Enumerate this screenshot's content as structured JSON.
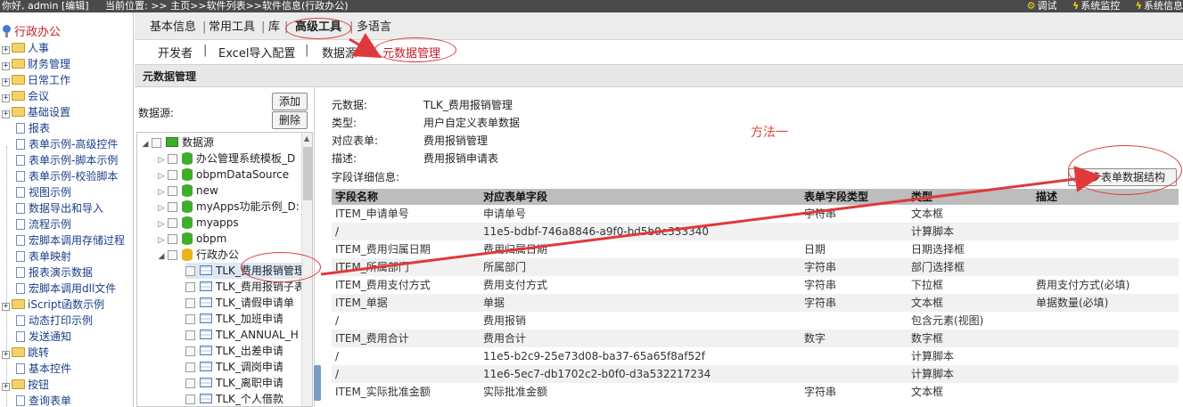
{
  "topbar": {
    "greeting": "你好, admin [编辑]",
    "location": "当前位置: >> 主页>>软件列表>>软件信息(行政办公)",
    "links": [
      "调试",
      "系统监控",
      "系统信息"
    ]
  },
  "left_tree": {
    "root": "行政办公",
    "folders": [
      "人事",
      "财务管理",
      "日常工作",
      "会议",
      "基础设置"
    ],
    "items": [
      "报表",
      "表单示例-高级控件",
      "表单示例-脚本示例",
      "表单示例-校验脚本",
      "视图示例",
      "数据导出和导入",
      "流程示例",
      "宏脚本调用存储过程",
      "表单映射",
      "报表演示数据",
      "宏脚本调用dll文件"
    ],
    "folders2": [
      "iScript函数示例"
    ],
    "items2": [
      "动态打印示例",
      "发送通知"
    ],
    "folders3": [
      "跳转"
    ],
    "items3": [
      "基本控件"
    ],
    "folders4": [
      "按钮"
    ],
    "items4": [
      "查询表单"
    ]
  },
  "tabs": [
    "基本信息",
    "常用工具",
    "库",
    "高级工具",
    "多语言"
  ],
  "subtabs": [
    "开发者",
    "Excel导入配置",
    "数据源",
    "元数据管理"
  ],
  "panel_title": "元数据管理",
  "datasource": {
    "label": "数据源:",
    "add_btn": "添加",
    "del_btn": "删除",
    "root": "数据源",
    "sources": [
      "办公管理系统模板_D",
      "obpmDataSource",
      "new",
      "myApps功能示例_D:",
      "myapps",
      "obpm"
    ],
    "app": "行政办公",
    "tables": [
      "TLK_费用报销管理",
      "TLK_费用报销子表",
      "TLK_请假申请单",
      "TLK_加班申请",
      "TLK_ANNUAL_H",
      "TLK_出差申请",
      "TLK_调岗申请",
      "TLK_离职申请",
      "TLK_个人借款"
    ]
  },
  "meta": {
    "fields": [
      {
        "k": "元数据:",
        "v": "TLK_费用报销管理"
      },
      {
        "k": "类型:",
        "v": "用户自定义表单数据"
      },
      {
        "k": "对应表单:",
        "v": "费用报销管理"
      },
      {
        "k": "描述:",
        "v": "费用报销申请表"
      },
      {
        "k": "字段详细信息:",
        "v": ""
      }
    ],
    "note": "方法一",
    "sync_btn": "同步表单数据结构"
  },
  "table": {
    "headers": [
      "字段名称",
      "对应表单字段",
      "表单字段类型",
      "类型",
      "描述"
    ],
    "rows": [
      [
        "ITEM_申请单号",
        "申请单号",
        "字符串",
        "文本框",
        ""
      ],
      [
        "/",
        "11e5-bdbf-746a8846-a9f0-bd5b0e333340",
        "",
        "计算脚本",
        ""
      ],
      [
        "ITEM_费用归属日期",
        "费用归属日期",
        "日期",
        "日期选择框",
        ""
      ],
      [
        "ITEM_所属部门",
        "所属部门",
        "字符串",
        "部门选择框",
        ""
      ],
      [
        "ITEM_费用支付方式",
        "费用支付方式",
        "字符串",
        "下拉框",
        "费用支付方式(必填)"
      ],
      [
        "ITEM_单据",
        "单据",
        "字符串",
        "文本框",
        "单据数量(必填)"
      ],
      [
        "/",
        "费用报销",
        "",
        "包含元素(视图)",
        ""
      ],
      [
        "ITEM_费用合计",
        "费用合计",
        "数字",
        "数字框",
        ""
      ],
      [
        "/",
        "11e5-b2c9-25e73d08-ba37-65a65f8af52f",
        "",
        "计算脚本",
        ""
      ],
      [
        "/",
        "11e6-5ec7-db1702c2-b0f0-d3a532217234",
        "",
        "计算脚本",
        ""
      ],
      [
        "ITEM_实际批准金额",
        "实际批准金额",
        "字符串",
        "文本框",
        ""
      ]
    ]
  },
  "colors": {
    "annotation": "#e0393b",
    "header_bg": "#bdbdbd"
  }
}
